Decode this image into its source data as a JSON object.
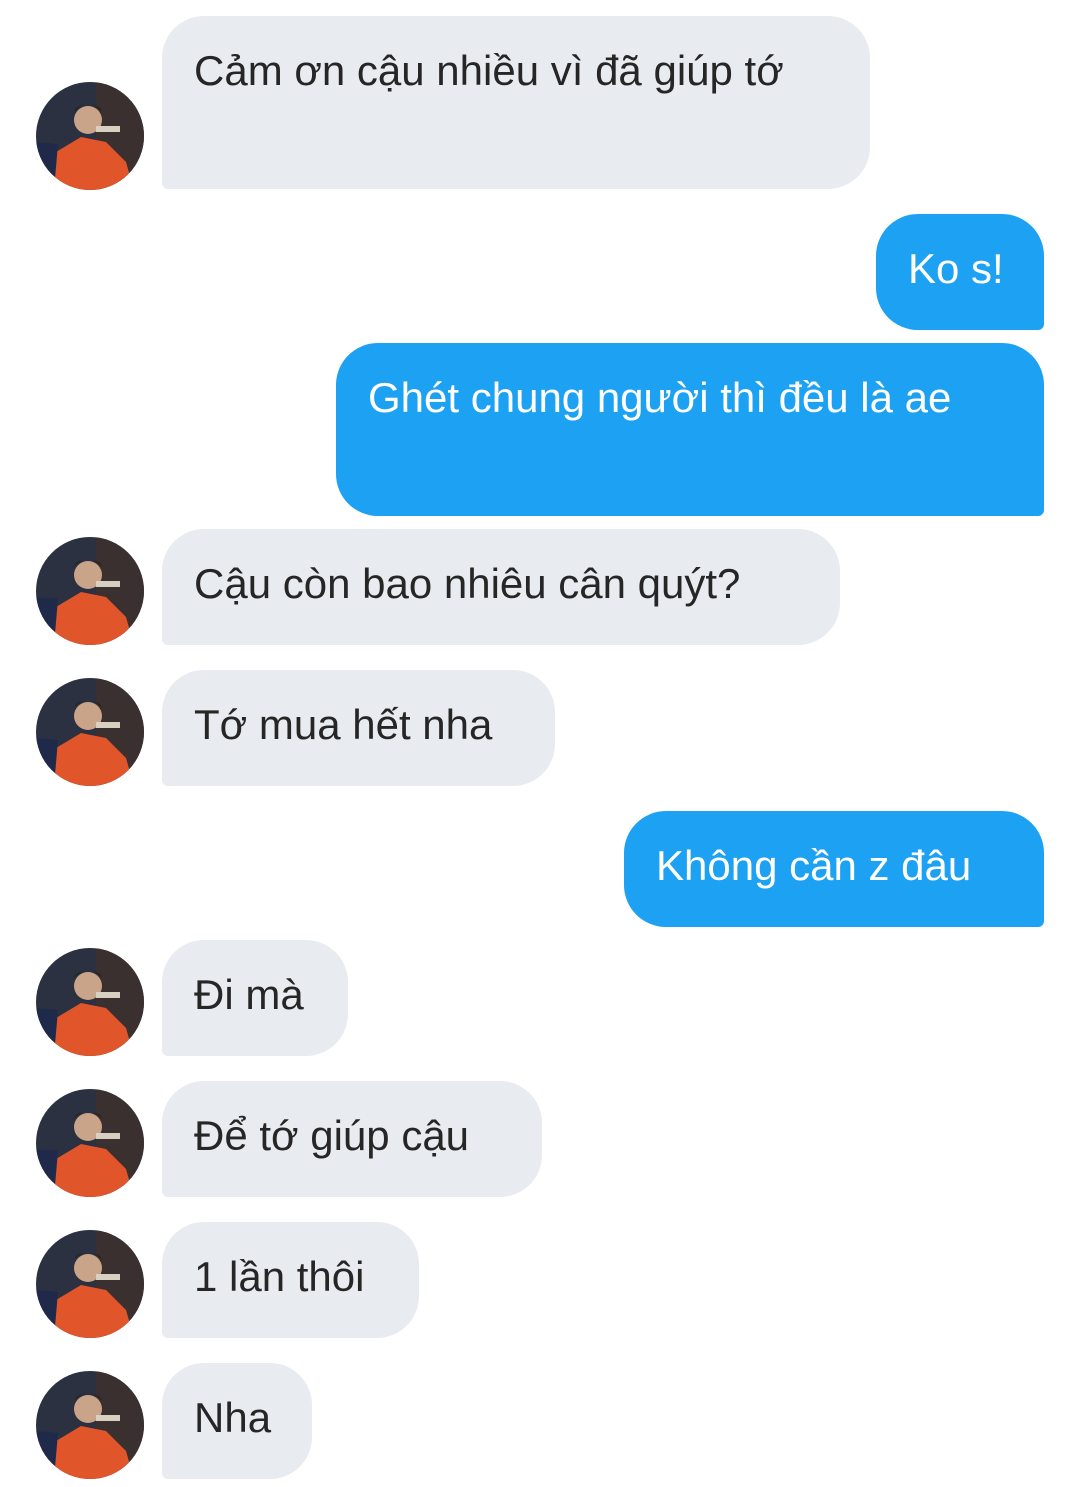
{
  "conversation": {
    "messages": [
      {
        "side": "in",
        "text": "Cảm ơn cậu nhiều vì đã giúp tớ",
        "avatar": "contact-avatar"
      },
      {
        "side": "out",
        "text": "Ko s!"
      },
      {
        "side": "out",
        "text": "Ghét chung người thì đều là ae"
      },
      {
        "side": "in",
        "text": "Cậu còn bao nhiêu cân quýt?",
        "avatar": "contact-avatar"
      },
      {
        "side": "in",
        "text": "Tớ mua hết nha",
        "avatar": "contact-avatar"
      },
      {
        "side": "out",
        "text": "Không cần z đâu"
      },
      {
        "side": "in",
        "text": "Đi mà",
        "avatar": "contact-avatar"
      },
      {
        "side": "in",
        "text": "Để tớ giúp cậu",
        "avatar": "contact-avatar"
      },
      {
        "side": "in",
        "text": "1 lần thôi",
        "avatar": "contact-avatar"
      },
      {
        "side": "in",
        "text": "Nha",
        "avatar": "contact-avatar"
      }
    ]
  },
  "colors": {
    "incoming_bubble": "#e8ecf0",
    "outgoing_bubble": "#1da1f2",
    "incoming_text": "#262626",
    "outgoing_text": "#ffffff"
  }
}
